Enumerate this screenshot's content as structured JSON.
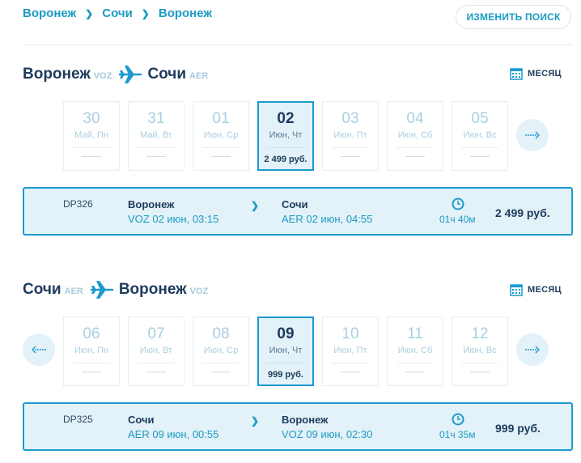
{
  "breadcrumb": [
    "Воронеж",
    "Сочи",
    "Воронеж"
  ],
  "change_search_label": "ИЗМЕНИТЬ ПОИСК",
  "legs": [
    {
      "from_city": "Воронеж",
      "from_code": "VOZ",
      "to_city": "Сочи",
      "to_code": "AER",
      "month_label": "МЕСЯЦ",
      "dates": [
        {
          "day": "30",
          "weekday": "Май, Пн"
        },
        {
          "day": "31",
          "weekday": "Май, Вт"
        },
        {
          "day": "01",
          "weekday": "Июн, Ср"
        },
        {
          "day": "02",
          "weekday": "Июн, Чт",
          "price": "2 499 руб.",
          "selected": true
        },
        {
          "day": "03",
          "weekday": "Июн, Пт"
        },
        {
          "day": "04",
          "weekday": "Июн, Сб"
        },
        {
          "day": "05",
          "weekday": "Июн, Вс"
        }
      ],
      "flight": {
        "number": "DP326",
        "dep_city": "Воронеж",
        "dep_time": "VOZ 02 июн, 03:15",
        "arr_city": "Сочи",
        "arr_time": "AER 02 июн, 04:55",
        "duration": "01ч 40м",
        "price": "2 499 руб."
      }
    },
    {
      "from_city": "Сочи",
      "from_code": "AER",
      "to_city": "Воронеж",
      "to_code": "VOZ",
      "month_label": "МЕСЯЦ",
      "dates": [
        {
          "day": "06",
          "weekday": "Июн, Пн"
        },
        {
          "day": "07",
          "weekday": "Июн, Вт"
        },
        {
          "day": "08",
          "weekday": "Июн, Ср"
        },
        {
          "day": "09",
          "weekday": "Июн, Чт",
          "price": "999 руб.",
          "selected": true
        },
        {
          "day": "10",
          "weekday": "Июн, Пт"
        },
        {
          "day": "11",
          "weekday": "Июн, Сб"
        },
        {
          "day": "12",
          "weekday": "Июн, Вс"
        }
      ],
      "flight": {
        "number": "DP325",
        "dep_city": "Сочи",
        "dep_time": "AER 09 июн, 00:55",
        "arr_city": "Воронеж",
        "arr_time": "VOZ 09 июн, 02:30",
        "duration": "01ч 35м",
        "price": "999 руб."
      }
    }
  ],
  "colors": {
    "accent": "#1b9ad0",
    "dark": "#1d3b5e",
    "light_bg": "#e3f1f8"
  }
}
